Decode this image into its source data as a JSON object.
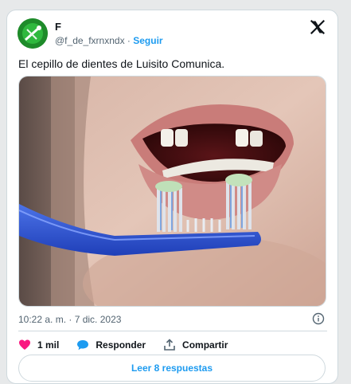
{
  "author": {
    "display_name": "F",
    "handle": "@f_de_fxrnxndx",
    "separator": "·",
    "follow_label": "Seguir"
  },
  "tweet": {
    "text": "El cepillo de dientes de Luisito Comunica.",
    "timestamp": "10:22 a. m. · 7 dic. 2023"
  },
  "actions": {
    "likes_count": "1 mil",
    "reply_label": "Responder",
    "share_label": "Compartir"
  },
  "replies": {
    "read_label": "Leer 8 respuestas"
  },
  "colors": {
    "accent": "#1d9bf0",
    "like": "#f91880",
    "text": "#0f1419",
    "muted": "#536471"
  },
  "icons": [
    "x-logo-icon",
    "info-icon",
    "heart-icon",
    "reply-bubble-icon",
    "share-icon"
  ]
}
